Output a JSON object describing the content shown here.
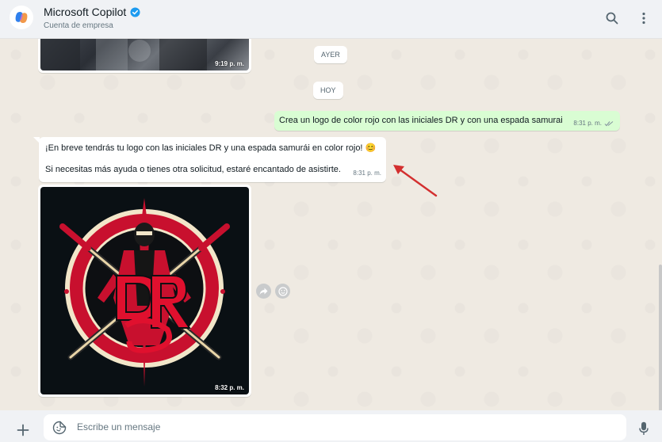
{
  "header": {
    "contact_name": "Microsoft Copilot",
    "contact_subtitle": "Cuenta de empresa",
    "verified_icon": "verified-badge-icon",
    "search_icon": "search-icon",
    "menu_icon": "more-vertical-icon"
  },
  "chat": {
    "earlier_image": {
      "time": "9:19 p. m."
    },
    "date_yesterday": "AYER",
    "date_today": "HOY",
    "outgoing": {
      "text": "Crea un logo de color rojo con las iniciales DR y con una espada samurai",
      "time": "8:31 p. m.",
      "status_icon": "double-check-icon"
    },
    "incoming": {
      "line1": "¡En breve tendrás tu logo con las iniciales DR y una espada samurái en color rojo! 😊",
      "line2": "Si necesitas más ayuda o tienes otra solicitud, estaré encantado de asistirte.",
      "time": "8:31 p. m."
    },
    "logo_image": {
      "time": "8:32 p. m."
    },
    "actions": [
      "forward-icon",
      "emoji-reaction-icon"
    ]
  },
  "composer": {
    "placeholder": "Escribe un mensaje",
    "attach_icon": "plus-icon",
    "sticker_icon": "sticker-icon",
    "mic_icon": "microphone-icon"
  },
  "colors": {
    "outgoing_bubble": "#d9fdd3",
    "incoming_bubble": "#ffffff",
    "chat_bg": "#efeae2",
    "annotation_arrow": "#d32f2f",
    "verified": "#1d9bf0"
  }
}
